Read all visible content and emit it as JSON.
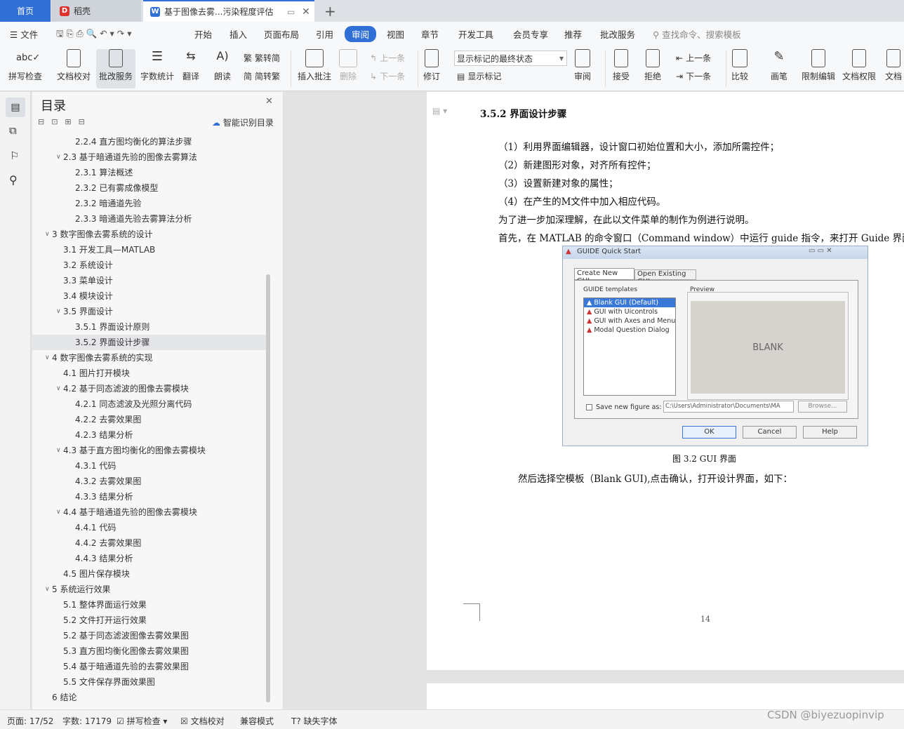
{
  "tabs": {
    "home": "首页",
    "daoke": "稻壳",
    "doc": "基于图像去雾...污染程度评估"
  },
  "menu": {
    "file": "文件",
    "items": [
      "开始",
      "插入",
      "页面布局",
      "引用",
      "审阅",
      "视图",
      "章节",
      "开发工具",
      "会员专享",
      "推荐",
      "批改服务"
    ],
    "search": "查找命令、搜索模板"
  },
  "ribbon": {
    "spell": "拼写检查",
    "proof": "文档校对",
    "review_service": "批改服务",
    "wordcount": "字数统计",
    "translate": "翻译",
    "read": "朗读",
    "trad": "繁转简",
    "simp": "简转繁",
    "insert_comment": "插入批注",
    "delete": "删除",
    "prev": "上一条",
    "next": "下一条",
    "track": "修订",
    "show_state": "显示标记的最终状态",
    "show_marks": "显示标记",
    "review": "审阅",
    "accept": "接受",
    "reject": "拒绝",
    "prev2": "上一条",
    "next2": "下一条",
    "compare": "比较",
    "pen": "画笔",
    "restrict": "限制编辑",
    "perm": "文档权限",
    "doc_more": "文档"
  },
  "toc": {
    "title": "目录",
    "smart": "智能识别目录",
    "items": [
      {
        "t": "2.2.4  直方图均衡化的算法步骤",
        "lvl": 3
      },
      {
        "t": "2.3  基于暗通道先验的图像去雾算法",
        "lvl": 2,
        "c": true
      },
      {
        "t": "2.3.1  算法概述",
        "lvl": 3
      },
      {
        "t": "2.3.2  已有雾成像模型",
        "lvl": 3
      },
      {
        "t": "2.3.2  暗通道先验",
        "lvl": 3
      },
      {
        "t": "2.3.3  暗通道先验去雾算法分析",
        "lvl": 3
      },
      {
        "t": "3  数字图像去雾系统的设计",
        "lvl": 1,
        "c": true
      },
      {
        "t": "3.1  开发工具—MATLAB",
        "lvl": 2
      },
      {
        "t": "3.2 系统设计",
        "lvl": 2
      },
      {
        "t": "3.3  菜单设计",
        "lvl": 2
      },
      {
        "t": "3.4  模块设计",
        "lvl": 2
      },
      {
        "t": "3.5  界面设计",
        "lvl": 2,
        "c": true
      },
      {
        "t": "3.5.1  界面设计原则",
        "lvl": 3
      },
      {
        "t": "3.5.2  界面设计步骤",
        "lvl": 3,
        "sel": true
      },
      {
        "t": "4  数字图像去雾系统的实现",
        "lvl": 1,
        "c": true
      },
      {
        "t": "4.1 图片打开模块",
        "lvl": 2
      },
      {
        "t": "4.2 基于同态滤波的图像去雾模块",
        "lvl": 2,
        "c": true
      },
      {
        "t": "4.2.1    同态滤波及光照分离代码",
        "lvl": 3
      },
      {
        "t": "4.2.2  去雾效果图",
        "lvl": 3
      },
      {
        "t": "4.2.3  结果分析",
        "lvl": 3
      },
      {
        "t": "4.3 基于直方图均衡化的图像去雾模块",
        "lvl": 2,
        "c": true
      },
      {
        "t": "4.3.1  代码",
        "lvl": 3
      },
      {
        "t": "4.3.2  去雾效果图",
        "lvl": 3
      },
      {
        "t": "4.3.3  结果分析",
        "lvl": 3
      },
      {
        "t": "4.4 基于暗通道先验的图像去雾模块",
        "lvl": 2,
        "c": true
      },
      {
        "t": "4.4.1 代码",
        "lvl": 3
      },
      {
        "t": "4.4.2  去雾效果图",
        "lvl": 3
      },
      {
        "t": "4.4.3  结果分析",
        "lvl": 3
      },
      {
        "t": "4.5 图片保存模块",
        "lvl": 2
      },
      {
        "t": "5  系统运行效果",
        "lvl": 1,
        "c": true
      },
      {
        "t": "5.1  整体界面运行效果",
        "lvl": 2
      },
      {
        "t": "5.2  文件打开运行效果",
        "lvl": 2
      },
      {
        "t": "5.2  基于同态滤波图像去雾效果图",
        "lvl": 2
      },
      {
        "t": "5.3 直方图均衡化图像去雾效果图",
        "lvl": 2
      },
      {
        "t": "5.4 基于暗通道先验的去雾效果图",
        "lvl": 2
      },
      {
        "t": "5.5 文件保存界面效果图",
        "lvl": 2
      },
      {
        "t": "6  结论",
        "lvl": 1
      }
    ]
  },
  "doc": {
    "heading": "3.5.2 界面设计步骤",
    "p1": "（1）利用界面编辑器，设计窗口初始位置和大小，添加所需控件；",
    "p2": "（2）新建图形对象，对齐所有控件；",
    "p3": "（3）设置新建对象的属性；",
    "p4": "（4）在产生的M文件中加入相应代码。",
    "p5": "为了进一步加深理解，在此以文件菜单的制作为例进行说明。",
    "p6": "首先，在 MATLAB 的命令窗口（Command window）中运行 guide 指令，来打开 Guide 界面，如",
    "caption": "图 3.2   GUI 界面",
    "p7": "然后选择空模板（Blank GUI),点击确认，打开设计界面，如下：",
    "page_num": "14"
  },
  "dialog": {
    "title": "GUIDE Quick Start",
    "tab1": "Create New GUI",
    "tab2": "Open Existing GUI",
    "templates_label": "GUIDE templates",
    "preview_label": "Preview",
    "templates": [
      "Blank GUI (Default)",
      "GUI with Uicontrols",
      "GUI with Axes and Menu",
      "Modal Question Dialog"
    ],
    "blank": "BLANK",
    "save_label": "Save new figure as:",
    "save_path": "C:\\Users\\Administrator\\Documents\\MA",
    "browse": "Browse...",
    "ok": "OK",
    "cancel": "Cancel",
    "help": "Help"
  },
  "status": {
    "page": "页面: 17/52",
    "words": "字数: 17179",
    "spell": "拼写检查",
    "proof": "文档校对",
    "compat": "兼容模式",
    "missing_font": "缺失字体"
  },
  "watermark": "CSDN @biyezuopinvip"
}
